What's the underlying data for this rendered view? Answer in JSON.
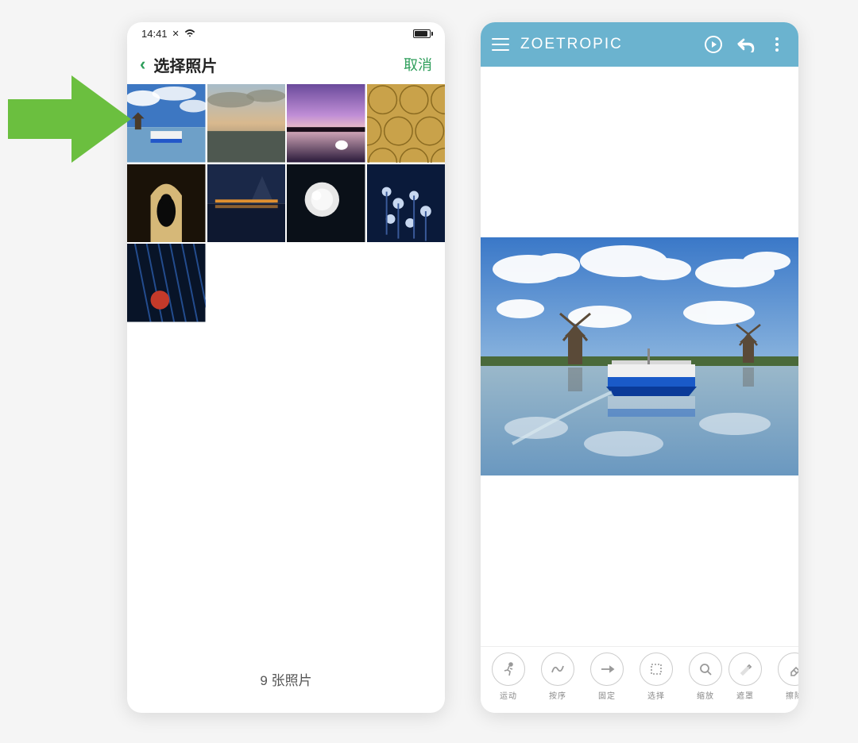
{
  "left": {
    "status_time": "14:41",
    "title": "选择照片",
    "cancel": "取消",
    "footer": "9 张照片",
    "accent": "#2e9e5b",
    "thumbs": [
      "windmill-sky",
      "cloud-reflection",
      "purple-lake-swan",
      "golden-pattern",
      "arch-silhouette",
      "city-night-water",
      "white-rose-dark",
      "blue-flowers",
      "blue-rain-flower"
    ]
  },
  "right": {
    "app_title": "ZOETROPIC",
    "header_bg": "#6bb3cf",
    "tools": [
      {
        "id": "motion",
        "label": "运动",
        "icon": "run"
      },
      {
        "id": "order",
        "label": "按序",
        "icon": "squiggle"
      },
      {
        "id": "fixed",
        "label": "固定",
        "icon": "anchor"
      },
      {
        "id": "select",
        "label": "选择",
        "icon": "marquee"
      },
      {
        "id": "zoom",
        "label": "缩放",
        "icon": "zoom"
      }
    ],
    "tools_right": [
      {
        "id": "mask",
        "label": "遮罩",
        "icon": "brush"
      },
      {
        "id": "erase",
        "label": "擦除",
        "icon": "eraser"
      }
    ]
  },
  "arrow_color": "#6bbf3f"
}
